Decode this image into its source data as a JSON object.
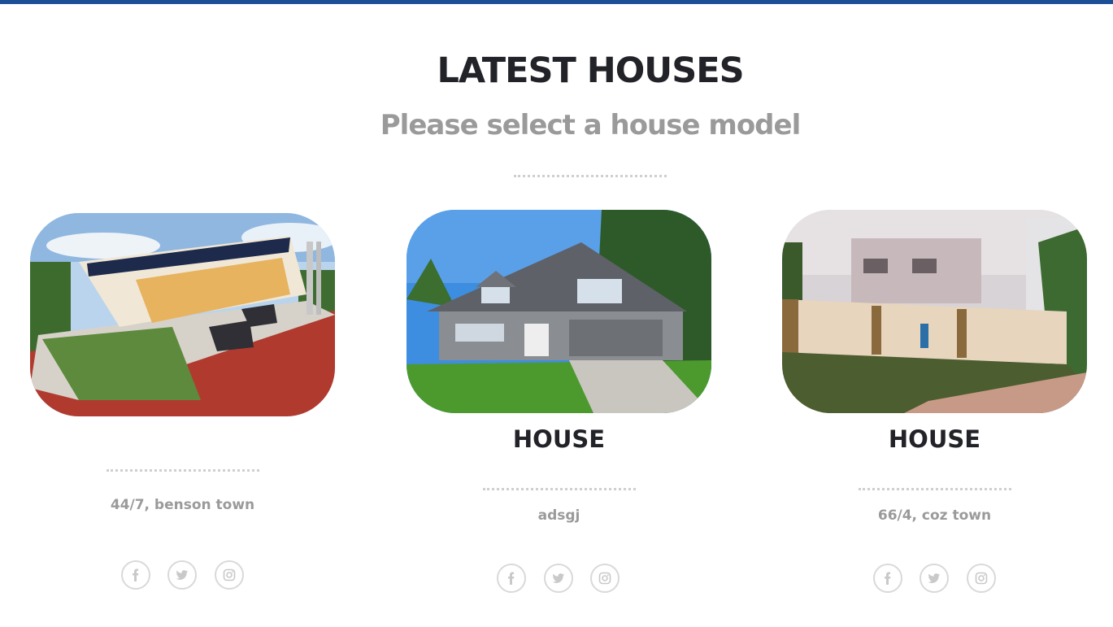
{
  "section": {
    "title": "LATEST HOUSES",
    "subtitle": "Please select a house model"
  },
  "houses": [
    {
      "title": "",
      "address": "44/7, benson town",
      "image": "rooftop-solar-house-photo",
      "social": [
        "facebook-icon",
        "twitter-icon",
        "instagram-icon"
      ]
    },
    {
      "title": "HOUSE",
      "address": "adsgj",
      "image": "gray-two-story-house-photo",
      "social": [
        "facebook-icon",
        "twitter-icon",
        "instagram-icon"
      ]
    },
    {
      "title": "HOUSE",
      "address": "66/4, coz town",
      "image": "yard-with-wall-photo",
      "social": [
        "facebook-icon",
        "twitter-icon",
        "instagram-icon"
      ]
    }
  ],
  "colors": {
    "top_bar": "#1b4f96",
    "heading": "#222328",
    "muted_text": "#9a9a9a",
    "divider": "#cfcfcf"
  }
}
